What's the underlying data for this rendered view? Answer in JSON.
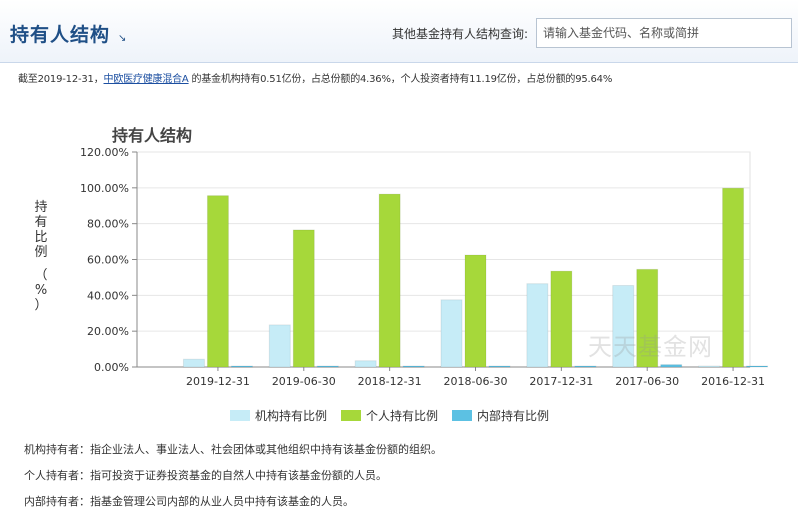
{
  "header": {
    "title": "持有人结构",
    "title_arrow": "↘",
    "query_label": "其他基金持有人结构查询:",
    "search_placeholder": "请输入基金代码、名称或简拼"
  },
  "summary": {
    "prefix": "截至2019-12-31，",
    "fund_name": "中欧医疗健康混合A",
    "suffix": " 的基金机构持有0.51亿份，占总份额的4.36%，个人投资者持有11.19亿份，占总份额的95.64%"
  },
  "watermark": "天天基金网",
  "chart_data": {
    "type": "bar",
    "title": "持有人结构",
    "ylabel": "持有比例（%）",
    "ylabel_chars": [
      "持",
      "有",
      "比",
      "例",
      "（",
      "%",
      "）"
    ],
    "categories": [
      "2019-12-31",
      "2019-06-30",
      "2018-12-31",
      "2018-06-30",
      "2017-12-31",
      "2017-06-30",
      "2016-12-31"
    ],
    "ylim": [
      0,
      120
    ],
    "yticks": [
      0,
      20,
      40,
      60,
      80,
      100,
      120
    ],
    "ytick_labels": [
      "0.00%",
      "20.00%",
      "40.00%",
      "60.00%",
      "80.00%",
      "100.00%",
      "120.00%"
    ],
    "grid": true,
    "legend_position": "bottom",
    "series": [
      {
        "name": "机构持有比例",
        "color": "#c6ecf7",
        "values": [
          4.36,
          23.5,
          3.5,
          37.5,
          46.5,
          45.5,
          0.2
        ]
      },
      {
        "name": "个人持有比例",
        "color": "#a6d83a",
        "values": [
          95.64,
          76.5,
          96.5,
          62.5,
          53.5,
          54.5,
          99.8
        ]
      },
      {
        "name": "内部持有比例",
        "color": "#5cc1e3",
        "values": [
          0.3,
          0.4,
          0.3,
          0.4,
          0.4,
          1.3,
          0.3
        ]
      }
    ]
  },
  "definitions": [
    "机构持有者：指企业法人、事业法人、社会团体或其他组织中持有该基金份额的组织。",
    "个人持有者：指可投资于证券投资基金的自然人中持有该基金份额的人员。",
    "内部持有者：指基金管理公司内部的从业人员中持有该基金的人员。"
  ]
}
